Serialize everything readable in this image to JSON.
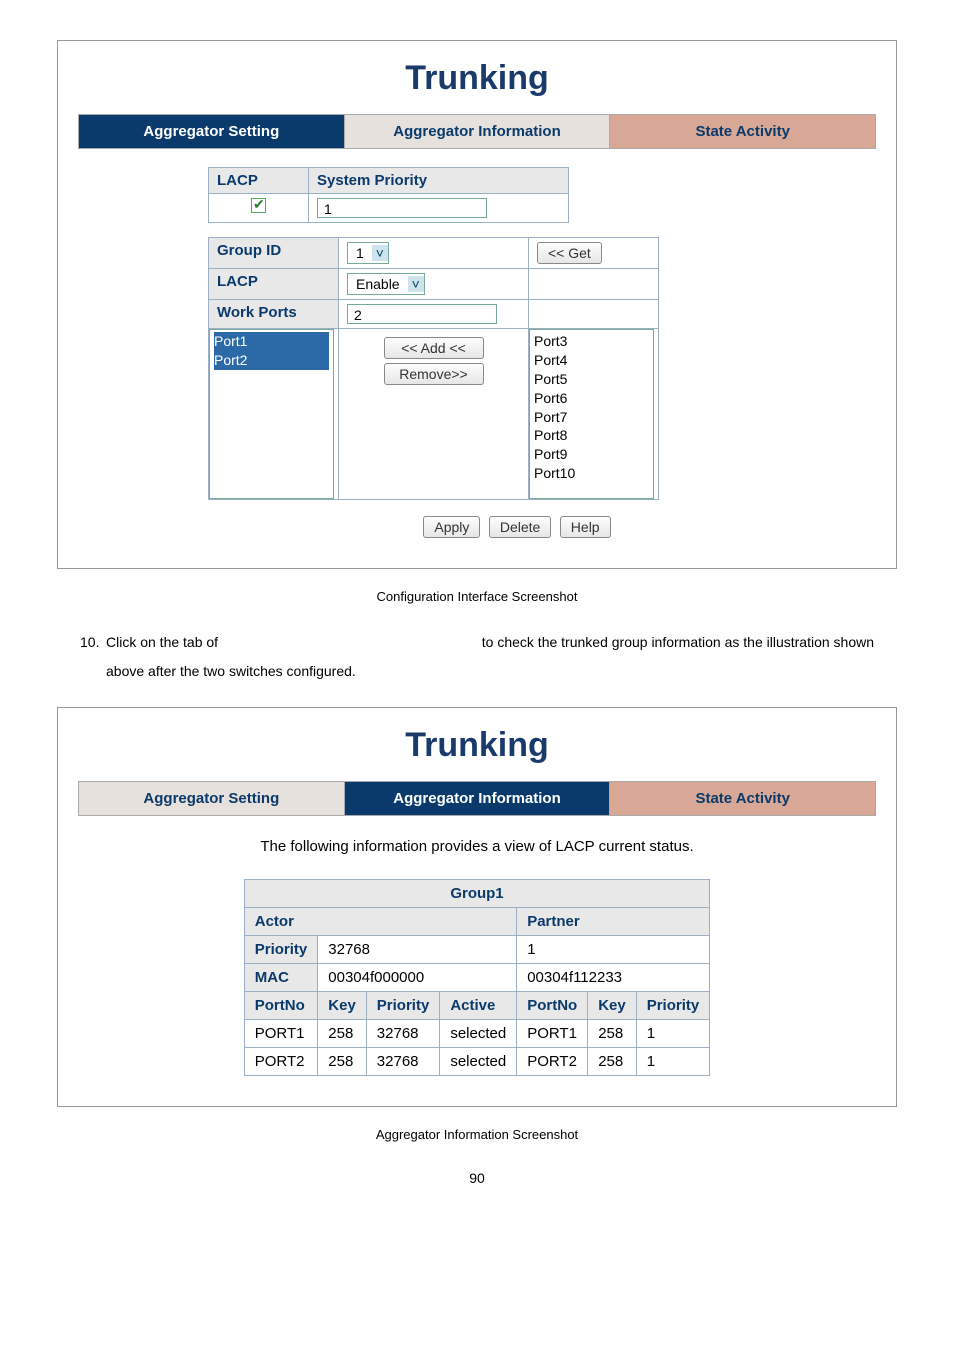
{
  "figure1": {
    "title": "Trunking",
    "tabs": {
      "setting": "Aggregator Setting",
      "info": "Aggregator Information",
      "state": "State Activity"
    },
    "lacp_label": "LACP",
    "lacp_checked": true,
    "sys_prio_label": "System Priority",
    "sys_prio_value": "1",
    "group_id_label": "Group ID",
    "group_id_value": "1",
    "get_btn": "<< Get",
    "lacp_row_label": "LACP",
    "lacp_mode": "Enable",
    "work_ports_label": "Work Ports",
    "work_ports_value": "2",
    "left_ports": [
      "Port1",
      "Port2"
    ],
    "add_btn": "<< Add <<",
    "remove_btn": "Remove>>",
    "right_ports": [
      "Port3",
      "Port4",
      "Port5",
      "Port6",
      "Port7",
      "Port8",
      "Port9",
      "Port10"
    ],
    "apply_btn": "Apply",
    "delete_btn": "Delete",
    "help_btn": "Help"
  },
  "caption1": "Configuration Interface Screenshot",
  "step": {
    "num": "10.",
    "pre": "Click on the tab of",
    "post": "to check the trunked group information as the illustration shown",
    "line2": "above after the two switches configured."
  },
  "figure2": {
    "title": "Trunking",
    "tabs": {
      "setting": "Aggregator Setting",
      "info": "Aggregator Information",
      "state": "State Activity"
    },
    "note": "The following information provides a view of LACP current status.",
    "group_label": "Group1",
    "actor_label": "Actor",
    "partner_label": "Partner",
    "priority_label": "Priority",
    "actor_priority": "32768",
    "partner_priority": "1",
    "mac_label": "MAC",
    "actor_mac": "00304f000000",
    "partner_mac": "00304f112233",
    "cols_actor": {
      "portno": "PortNo",
      "key": "Key",
      "priority": "Priority",
      "active": "Active"
    },
    "cols_partner": {
      "portno": "PortNo",
      "key": "Key",
      "priority": "Priority"
    },
    "rows": [
      {
        "a_port": "PORT1",
        "a_key": "258",
        "a_prio": "32768",
        "a_active": "selected",
        "p_port": "PORT1",
        "p_key": "258",
        "p_prio": "1"
      },
      {
        "a_port": "PORT2",
        "a_key": "258",
        "a_prio": "32768",
        "a_active": "selected",
        "p_port": "PORT2",
        "p_key": "258",
        "p_prio": "1"
      }
    ]
  },
  "caption2": "Aggregator Information Screenshot",
  "page_number": "90"
}
